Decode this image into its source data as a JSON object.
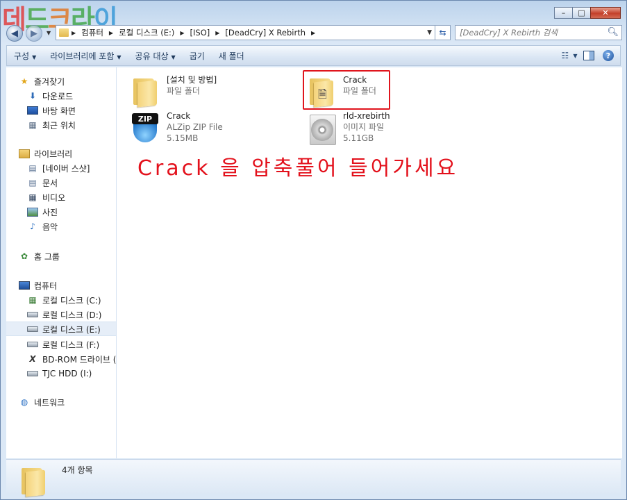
{
  "watermark": {
    "text": "데드크라이",
    "colors": [
      "#e04040",
      "#49a84a",
      "#e07a2a",
      "#45a84f",
      "#3a9ad8"
    ]
  },
  "window": {
    "buttons": {
      "minimize": "–",
      "maximize": "□",
      "close": "✕"
    }
  },
  "nav": {
    "back_glyph": "◀",
    "forward_glyph": "▶",
    "breadcrumb": [
      "컴퓨터",
      "로컬 디스크 (E:)",
      "[ISO]",
      "[DeadCry] X Rebirth"
    ],
    "search_placeholder": "[DeadCry] X Rebirth 검색"
  },
  "toolbar": {
    "items": [
      "구성",
      "라이브러리에 포함",
      "공유 대상",
      "굽기",
      "새 폴더"
    ],
    "with_dropdown": [
      true,
      true,
      true,
      false,
      false
    ]
  },
  "sidebar": {
    "favorites": {
      "label": "즐겨찾기",
      "items": [
        "다운로드",
        "바탕 화면",
        "최근 위치"
      ]
    },
    "libraries": {
      "label": "라이브러리",
      "items": [
        "[네이버 스샷]",
        "문서",
        "비디오",
        "사진",
        "음악"
      ]
    },
    "homegroup": {
      "label": "홈 그룹"
    },
    "computer": {
      "label": "컴퓨터",
      "items": [
        "로컬 디스크 (C:)",
        "로컬 디스크 (D:)",
        "로컬 디스크 (E:)",
        "로컬 디스크 (F:)",
        "BD-ROM 드라이브 (",
        "TJC HDD (I:)"
      ],
      "selected_index": 2
    },
    "network": {
      "label": "네트워크"
    }
  },
  "files": [
    {
      "name": "[설치 및 방법]",
      "type": "파일 폴더",
      "size": "",
      "icon": "folder-icon"
    },
    {
      "name": "Crack",
      "type": "파일 폴더",
      "size": "",
      "icon": "folder-icon",
      "highlighted": true
    },
    {
      "name": "Crack",
      "type": "ALZip ZIP File",
      "size": "5.15MB",
      "icon": "zip-icon"
    },
    {
      "name": "rld-xrebirth",
      "type": "이미지 파일",
      "size": "5.11GB",
      "icon": "disc-image-icon"
    }
  ],
  "annotation": "Crack 을 압축풀어 들어가세요",
  "status": {
    "item_count": "4개 항목"
  },
  "colors": {
    "highlight_border": "#e0151d",
    "annotation_text": "#e3101b",
    "selection": "#e6eef8"
  }
}
